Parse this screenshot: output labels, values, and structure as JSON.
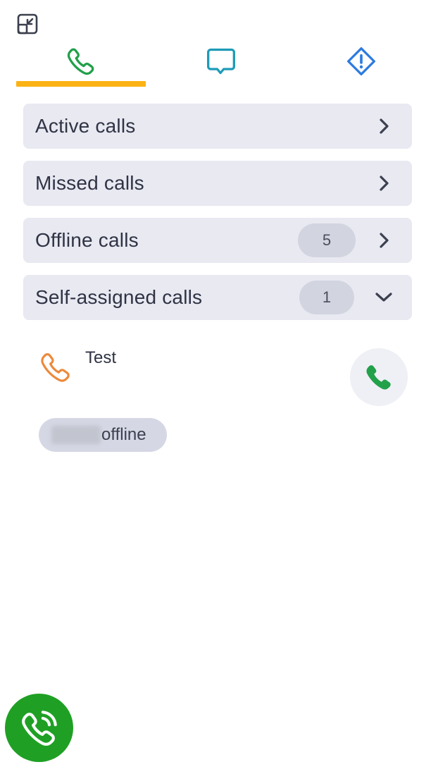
{
  "toolbar": {
    "minimize_icon": "minimize-window-icon"
  },
  "tabs": [
    {
      "id": "calls",
      "icon": "phone-icon",
      "active": true,
      "color": "#22a04a"
    },
    {
      "id": "chat",
      "icon": "chat-bubble-icon",
      "active": false,
      "color": "#1e9bb8"
    },
    {
      "id": "alerts",
      "icon": "warning-diamond-icon",
      "active": false,
      "color": "#2e7be0"
    }
  ],
  "accent_color": "#fbb214",
  "sections": [
    {
      "label": "Active calls",
      "count": "",
      "expanded": false
    },
    {
      "label": "Missed calls",
      "count": "",
      "expanded": false
    },
    {
      "label": "Offline calls",
      "count": "5",
      "expanded": false
    },
    {
      "label": "Self-assigned calls",
      "count": "1",
      "expanded": true
    }
  ],
  "self_assigned_calls": [
    {
      "name": "Test",
      "status": "offline",
      "icon": "phone-outline-icon",
      "icon_color": "#ec8a3c"
    }
  ],
  "fab": {
    "icon": "phone-ringing-icon",
    "color": "#1fa024"
  }
}
